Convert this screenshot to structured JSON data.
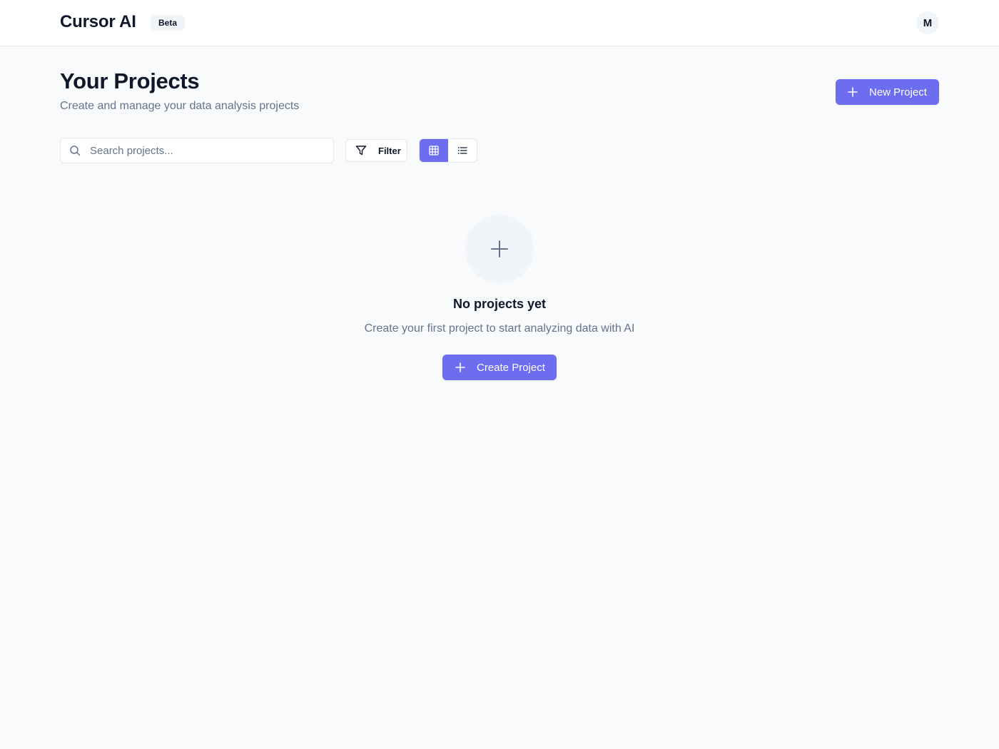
{
  "header": {
    "brand": "Cursor AI",
    "badge": "Beta",
    "avatar_initial": "M"
  },
  "page": {
    "title": "Your Projects",
    "subtitle": "Create and manage your data analysis projects",
    "new_project_label": "New Project"
  },
  "toolbar": {
    "search_placeholder": "Search projects...",
    "search_value": "",
    "filter_label": "Filter",
    "view_mode": "grid"
  },
  "empty_state": {
    "title": "No projects yet",
    "description": "Create your first project to start analyzing data with AI",
    "button_label": "Create Project"
  },
  "icons": {
    "new_project": "plus-icon",
    "search": "search-icon",
    "filter": "filter-icon",
    "grid_view": "grid-icon",
    "list_view": "list-icon",
    "empty_state": "plus-icon",
    "create_project": "plus-icon"
  },
  "colors": {
    "primary": "#6d6df0",
    "background": "#f8fafc",
    "text": "#0f172a",
    "muted_text": "#64748b"
  }
}
